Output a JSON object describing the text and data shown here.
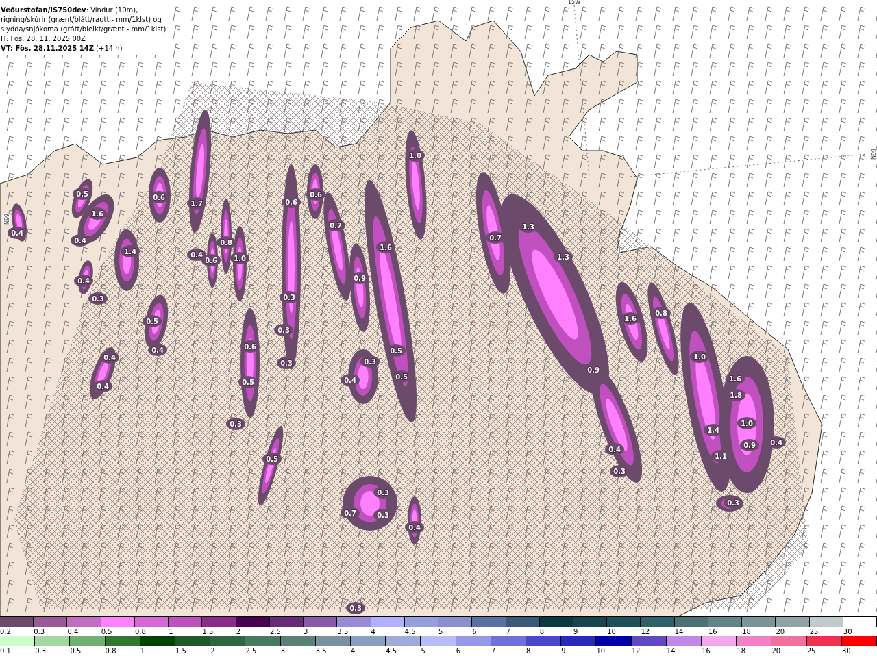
{
  "title_box": {
    "source": "Veðurstofan/IS750dev",
    "description": ": Vindur (10m), rigning/skúrir (grænt/blátt/rautt - mm/1klst) og slydda/snjókoma (grátt/bleikt/grænt - mm/1klst)",
    "init_time": "IT: Fös. 28. 11. 2025 00Z",
    "valid_time": "VT: Fös. 28.11.2025 14Z",
    "lead": "(+14 h)"
  },
  "map": {
    "grid_labels": [
      "15W",
      "66N",
      "66N"
    ],
    "values": [
      "0.5",
      "1.6",
      "0.4",
      "0.4",
      "1.4",
      "0.4",
      "0.3",
      "0.5",
      "0.4",
      "0.4",
      "0.4",
      "0.6",
      "1.7",
      "0.8",
      "0.4",
      "0.6",
      "1.0",
      "0.6",
      "0.6",
      "0.7",
      "1.6",
      "0.9",
      "1.0",
      "0.3",
      "0.3",
      "0.3",
      "0.6",
      "0.5",
      "0.3",
      "0.5",
      "0.3",
      "0.4",
      "0.5",
      "0.5",
      "0.7",
      "1.3",
      "1.3",
      "1.6",
      "0.8",
      "0.9",
      "1.0",
      "1.6",
      "1.8",
      "1.0",
      "1.4",
      "0.9",
      "0.4",
      "1.1",
      "0.4",
      "0.3",
      "0.3",
      "0.3",
      "0.3",
      "0.7",
      "0.4",
      "0.3"
    ]
  },
  "snow_scale": [
    {
      "label": "0.2",
      "color": "#6b4a6b"
    },
    {
      "label": "0.3",
      "color": "#9a5a9a"
    },
    {
      "label": "0.4",
      "color": "#c46cc4"
    },
    {
      "label": "0.5",
      "color": "#ff80ff"
    },
    {
      "label": "0.8",
      "color": "#d868d8"
    },
    {
      "label": "1",
      "color": "#c050c0"
    },
    {
      "label": "1.5",
      "color": "#8a2a8a"
    },
    {
      "label": "2",
      "color": "#4a0050"
    },
    {
      "label": "2.5",
      "color": "#6a2a7a"
    },
    {
      "label": "3",
      "color": "#8a5aaa"
    },
    {
      "label": "3.5",
      "color": "#9a8ad8"
    },
    {
      "label": "4",
      "color": "#b0b0ff"
    },
    {
      "label": "4.5",
      "color": "#96a0e0"
    },
    {
      "label": "5",
      "color": "#8890d0"
    },
    {
      "label": "6",
      "color": "#5a70a0"
    },
    {
      "label": "7",
      "color": "#3a5878"
    },
    {
      "label": "8",
      "color": "#0a3a40"
    },
    {
      "label": "9",
      "color": "#15454f"
    },
    {
      "label": "10",
      "color": "#1e5058"
    },
    {
      "label": "12",
      "color": "#2d6068"
    },
    {
      "label": "14",
      "color": "#4a7078"
    },
    {
      "label": "16",
      "color": "#608488"
    },
    {
      "label": "18",
      "color": "#7a9498"
    },
    {
      "label": "20",
      "color": "#90a4a8"
    },
    {
      "label": "25",
      "color": "#c0cccc"
    },
    {
      "label": "30",
      "color": "#ffffff"
    }
  ],
  "rain_scale": [
    {
      "label": "0.1",
      "color": "#ccffcc"
    },
    {
      "label": "0.3",
      "color": "#a0d8a0"
    },
    {
      "label": "0.5",
      "color": "#70b070"
    },
    {
      "label": "0.8",
      "color": "#307830"
    },
    {
      "label": "1",
      "color": "#004400"
    },
    {
      "label": "1.5",
      "color": "#1e5a28"
    },
    {
      "label": "2",
      "color": "#2e6640"
    },
    {
      "label": "2.5",
      "color": "#487a60"
    },
    {
      "label": "3",
      "color": "#5a8078"
    },
    {
      "label": "3.5",
      "color": "#7a92a0"
    },
    {
      "label": "4",
      "color": "#8a9ec0"
    },
    {
      "label": "4.5",
      "color": "#a0acd8"
    },
    {
      "label": "5",
      "color": "#b8bcf8"
    },
    {
      "label": "6",
      "color": "#9898e8"
    },
    {
      "label": "7",
      "color": "#7070d8"
    },
    {
      "label": "8",
      "color": "#4a4ac8"
    },
    {
      "label": "9",
      "color": "#2a2ab8"
    },
    {
      "label": "10",
      "color": "#0000a8"
    },
    {
      "label": "12",
      "color": "#6048c0"
    },
    {
      "label": "14",
      "color": "#c088e8"
    },
    {
      "label": "16",
      "color": "#f4a8ec"
    },
    {
      "label": "18",
      "color": "#f080c8"
    },
    {
      "label": "20",
      "color": "#f070a0"
    },
    {
      "label": "25",
      "color": "#f03050"
    },
    {
      "label": "30",
      "color": "#ff0000"
    }
  ]
}
